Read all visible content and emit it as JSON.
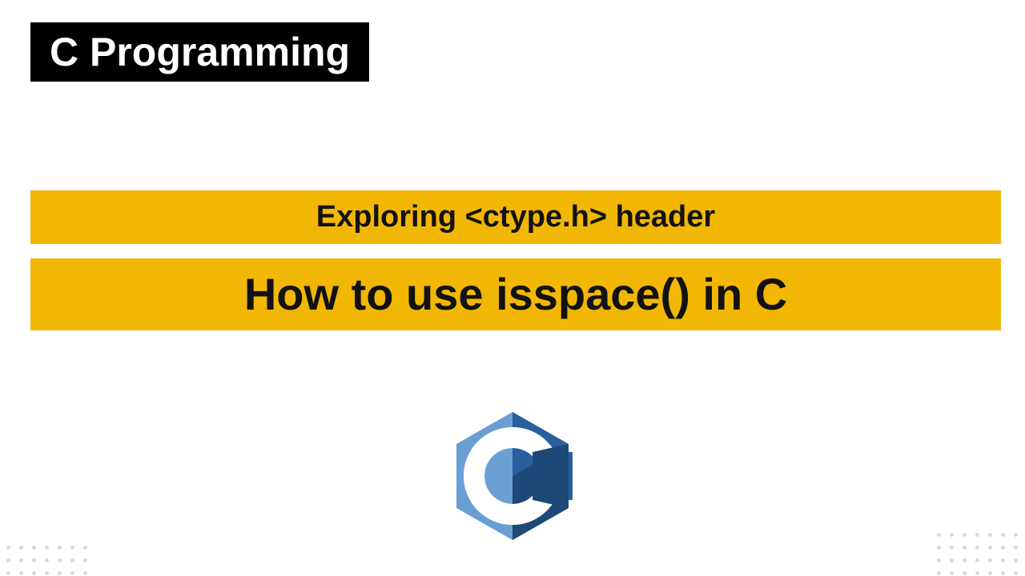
{
  "header": {
    "title": "C Programming"
  },
  "banners": {
    "subtitle": "Exploring <ctype.h> header",
    "title": "How to use isspace() in C"
  },
  "logo": {
    "name": "c-language-logo",
    "letter": "C"
  },
  "colors": {
    "accent": "#f2b705",
    "headerBg": "#000000",
    "headerFg": "#ffffff",
    "text": "#121212",
    "logoLight": "#6a9fd4",
    "logoDark": "#2a5f9e"
  }
}
